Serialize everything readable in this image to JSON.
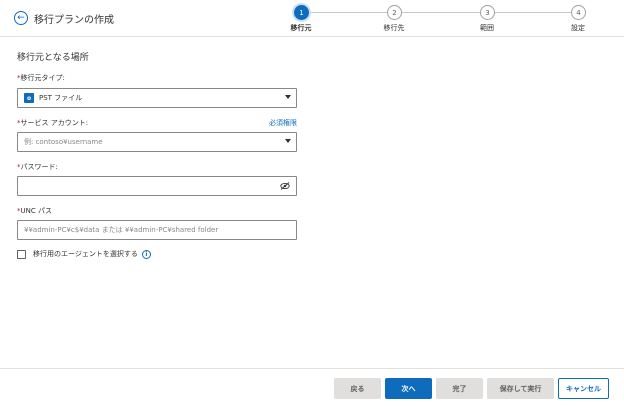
{
  "header": {
    "title": "移行プランの作成",
    "steps": [
      {
        "number": "1",
        "label": "移行元",
        "active": true
      },
      {
        "number": "2",
        "label": "移行先",
        "active": false
      },
      {
        "number": "3",
        "label": "範囲",
        "active": false
      },
      {
        "number": "4",
        "label": "設定",
        "active": false
      }
    ]
  },
  "main": {
    "section_title": "移行元となる場所",
    "source_type": {
      "required_mark": "*",
      "label": "移行元タイプ:",
      "value": "PST ファイル",
      "icon": "outlook-pst-icon"
    },
    "service_account": {
      "required_mark": "*",
      "label": "サービス アカウント:",
      "link": "必須権限",
      "placeholder": "例: contoso¥username"
    },
    "password": {
      "required_mark": "*",
      "label": "パスワード:",
      "value": ""
    },
    "unc_path": {
      "required_mark": "*",
      "label": "UNC パス",
      "placeholder": "¥¥admin-PC¥c$¥data または ¥¥admin-PC¥shared folder"
    },
    "agent_checkbox": {
      "label": "移行用のエージェントを選択する",
      "checked": false
    }
  },
  "footer": {
    "back": "戻る",
    "next": "次へ",
    "finish": "完了",
    "save_run": "保存して実行",
    "cancel": "キャンセル"
  },
  "colors": {
    "accent": "#0f6cbd",
    "required": "#a4262c",
    "disabled_bg": "#e1dfdd"
  }
}
